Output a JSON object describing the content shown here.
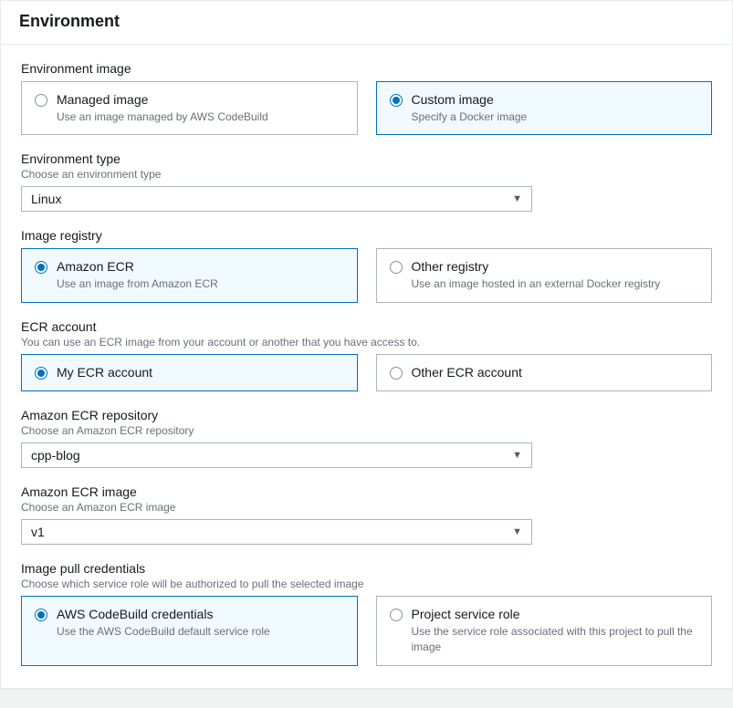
{
  "header": {
    "title": "Environment"
  },
  "env_image": {
    "label": "Environment image",
    "managed": {
      "title": "Managed image",
      "desc": "Use an image managed by AWS CodeBuild",
      "selected": false
    },
    "custom": {
      "title": "Custom image",
      "desc": "Specify a Docker image",
      "selected": true
    }
  },
  "env_type": {
    "label": "Environment type",
    "help": "Choose an environment type",
    "value": "Linux"
  },
  "image_registry": {
    "label": "Image registry",
    "ecr": {
      "title": "Amazon ECR",
      "desc": "Use an image from Amazon ECR",
      "selected": true
    },
    "other": {
      "title": "Other registry",
      "desc": "Use an image hosted in an external Docker registry",
      "selected": false
    }
  },
  "ecr_account": {
    "label": "ECR account",
    "help": "You can use an ECR image from your account or another that you have access to.",
    "mine": {
      "title": "My ECR account",
      "selected": true
    },
    "other": {
      "title": "Other ECR account",
      "selected": false
    }
  },
  "ecr_repo": {
    "label": "Amazon ECR repository",
    "help": "Choose an Amazon ECR repository",
    "value": "cpp-blog"
  },
  "ecr_image": {
    "label": "Amazon ECR image",
    "help": "Choose an Amazon ECR image",
    "value": "v1"
  },
  "pull_creds": {
    "label": "Image pull credentials",
    "help": "Choose which service role will be authorized to pull the selected image",
    "codebuild": {
      "title": "AWS CodeBuild credentials",
      "desc": "Use the AWS CodeBuild default service role",
      "selected": true
    },
    "project": {
      "title": "Project service role",
      "desc": "Use the service role associated with this project to pull the image",
      "selected": false
    }
  }
}
